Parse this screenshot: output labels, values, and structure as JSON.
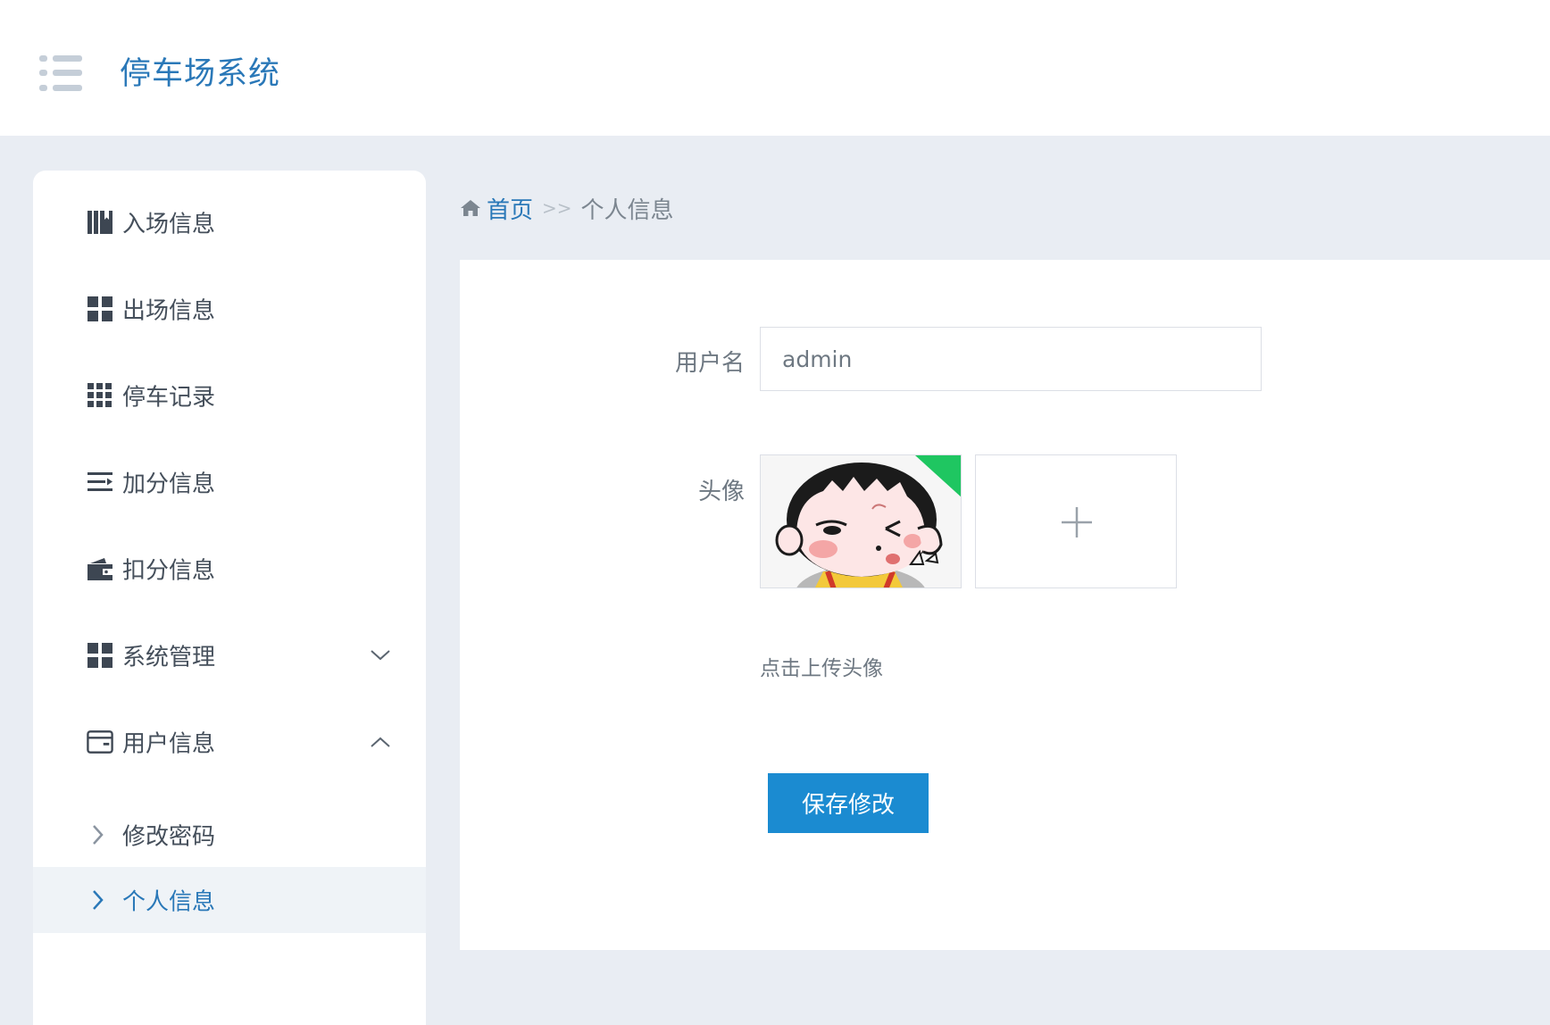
{
  "header": {
    "title": "停车场系统",
    "menu_icon": "hamburger-menu-icon"
  },
  "sidebar": {
    "items": [
      {
        "label": "入场信息",
        "icon": "book-icon"
      },
      {
        "label": "出场信息",
        "icon": "grid-icon"
      },
      {
        "label": "停车记录",
        "icon": "grid-nine-icon"
      },
      {
        "label": "加分信息",
        "icon": "list-lines-icon"
      },
      {
        "label": "扣分信息",
        "icon": "wallet-icon"
      },
      {
        "label": "系统管理",
        "icon": "grid-icon",
        "expanded": false
      },
      {
        "label": "用户信息",
        "icon": "card-icon",
        "expanded": true
      }
    ],
    "sub_items": [
      {
        "label": "修改密码",
        "active": false
      },
      {
        "label": "个人信息",
        "active": true
      }
    ]
  },
  "breadcrumb": {
    "home": "首页",
    "separator": ">>",
    "current": "个人信息"
  },
  "form": {
    "username_label": "用户名",
    "username_value": "admin",
    "avatar_label": "头像",
    "upload_hint": "点击上传头像",
    "save_label": "保存修改"
  },
  "colors": {
    "accent": "#2a78b8",
    "button": "#1b8bd1",
    "page_bg": "#e9edf3"
  }
}
